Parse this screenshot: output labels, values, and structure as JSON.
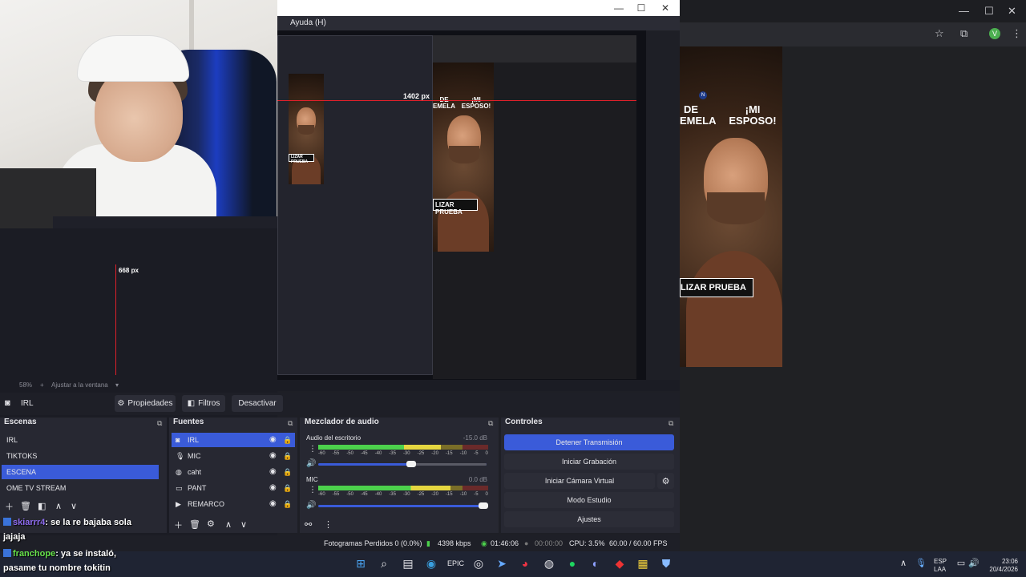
{
  "obs": {
    "menu_ayuda": "Ayuda (H)",
    "win_buttons": [
      "—",
      "☐",
      "✕"
    ],
    "preview_px_horizontal": "1402 px",
    "preview_px_vertical": "668 px",
    "zoom": "58%",
    "zoom_plus": "+",
    "fit_window": "Ajustar a la ventana",
    "scene_name": "IRL",
    "properties_label": "Propiedades",
    "filters_label": "Filtros",
    "deactivate_label": "Desactivar",
    "docks": {
      "scenes_title": "Escenas",
      "sources_title": "Fuentes",
      "mixer_title": "Mezclador de audio",
      "controls_title": "Controles"
    },
    "scenes": [
      "IRL",
      "TIKTOKS",
      "ESCENA",
      "OME TV STREAM"
    ],
    "sources": [
      {
        "name": "IRL",
        "icon": "camera-icon"
      },
      {
        "name": "MIC",
        "icon": "mic-icon"
      },
      {
        "name": "caht",
        "icon": "globe-icon"
      },
      {
        "name": "PANT",
        "icon": "monitor-icon"
      },
      {
        "name": "REMARCO",
        "icon": "play-icon"
      }
    ],
    "mixer": [
      {
        "name": "Audio del escritorio",
        "db": "-15.0 dB",
        "level": 0.72,
        "volume": 0.55
      },
      {
        "name": "MIC",
        "db": "0.0 dB",
        "level": 0.78,
        "volume": 0.98
      }
    ],
    "mixer_scale": [
      "-60",
      "-55",
      "-50",
      "-45",
      "-40",
      "-35",
      "-30",
      "-25",
      "-20",
      "-15",
      "-10",
      "-5",
      "0"
    ],
    "controls": {
      "stop_stream": "Detener Transmisión",
      "start_record": "Iniciar Grabación",
      "start_vcam": "Iniciar Cámara Virtual",
      "studio_mode": "Modo Estudio",
      "settings": "Ajustes"
    },
    "status": {
      "dropped": "Fotogramas Perdidos 0 (0.0%)",
      "bitrate": "4398 kbps",
      "stream_time": "01:46:06",
      "record_time": "00:00:00",
      "cpu": "CPU: 3.5%",
      "fps": "60.00 / 60.00 FPS"
    }
  },
  "ad": {
    "headline_left": "DE\nEMELA",
    "headline_right": "¡MI\nESPOSO!",
    "cta": "LIZAR PRUEBA",
    "badge": "N"
  },
  "chat": [
    {
      "user": "skiarrr4",
      "message": ": se la re bajaba sola",
      "cont": "jajaja"
    },
    {
      "user": "franchope",
      "message": ": ya se instaló,",
      "cont": "pasame tu nombre tokitin"
    }
  ],
  "taskbar": {
    "lang1": "ESP",
    "lang2": "LAA",
    "time": "23:06",
    "date": "20/4/2026"
  },
  "browser": {
    "avatar": "V"
  }
}
